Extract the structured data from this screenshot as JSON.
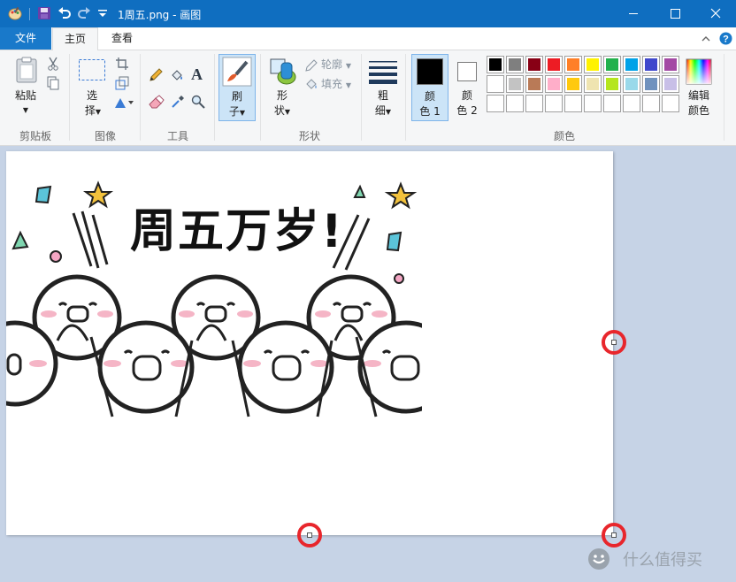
{
  "window": {
    "title": "1周五.png - 画图",
    "colors": {
      "titlebar": "#0f6ec0",
      "file_tab": "#1979ca",
      "canvas_bg": "#c6d3e6",
      "highlight": "#cce4f7"
    }
  },
  "quick_access": {
    "icons": [
      "paint-app-icon",
      "save-icon",
      "undo-icon",
      "redo-icon",
      "customize-toolbar-icon"
    ]
  },
  "tabs": {
    "file": "文件",
    "home": "主页",
    "view": "查看"
  },
  "ribbon": {
    "clipboard": {
      "paste": "粘贴",
      "group": "剪贴板"
    },
    "image": {
      "select_line1": "选",
      "select_line2": "择",
      "group": "图像"
    },
    "tools": {
      "group": "工具"
    },
    "brushes": {
      "line1": "刷",
      "line2": "子"
    },
    "shapes": {
      "line1": "形",
      "line2": "状",
      "outline": "轮廓",
      "fill": "填充",
      "group": "形状"
    },
    "size": {
      "line1": "粗",
      "line2": "细"
    },
    "colors": {
      "color1_line1": "颜",
      "color1_line2": "色 1",
      "color2_line1": "颜",
      "color2_line2": "色 2",
      "edit_line1": "编辑",
      "edit_line2": "颜色",
      "group": "颜色",
      "color1": "#000000",
      "color2": "#ffffff",
      "palette_row1": [
        "#000000",
        "#7f7f7f",
        "#880015",
        "#ed1c24",
        "#ff7f27",
        "#fff200",
        "#22b14c",
        "#00a2e8",
        "#3f48cc",
        "#a349a4"
      ],
      "palette_row2": [
        "#ffffff",
        "#c3c3c3",
        "#b97a57",
        "#ffaec9",
        "#ffc90e",
        "#efe4b0",
        "#b5e61d",
        "#99d9ea",
        "#7092be",
        "#c8bfe7"
      ],
      "palette_row3": [
        "#ffffff",
        "#ffffff",
        "#ffffff",
        "#ffffff",
        "#ffffff",
        "#ffffff",
        "#ffffff",
        "#ffffff",
        "#ffffff",
        "#ffffff"
      ]
    }
  },
  "picture": {
    "text": "周五万岁!"
  },
  "watermark": {
    "text": "什么值得买"
  }
}
